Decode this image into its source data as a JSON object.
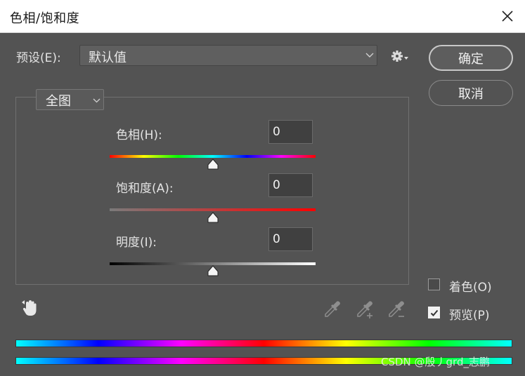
{
  "window": {
    "title": "色相/饱和度",
    "close_icon": "close-icon"
  },
  "preset": {
    "label": "预设(E):",
    "value": "默认值"
  },
  "buttons": {
    "ok": "确定",
    "cancel": "取消"
  },
  "range": {
    "value": "全图"
  },
  "adjustments": {
    "hue": {
      "label": "色相(H):",
      "value": "0"
    },
    "saturation": {
      "label": "饱和度(A):",
      "value": "0"
    },
    "lightness": {
      "label": "明度(I):",
      "value": "0"
    }
  },
  "options": {
    "colorize": {
      "label": "着色(O)",
      "checked": false
    },
    "preview": {
      "label": "预览(P)",
      "checked": true
    }
  },
  "watermark": "CSDN @殷丿grd_志鹏",
  "colors": {
    "dialog_bg": "#535353",
    "titlebar_bg": "#ffffff",
    "text": "#e3e3e3"
  }
}
